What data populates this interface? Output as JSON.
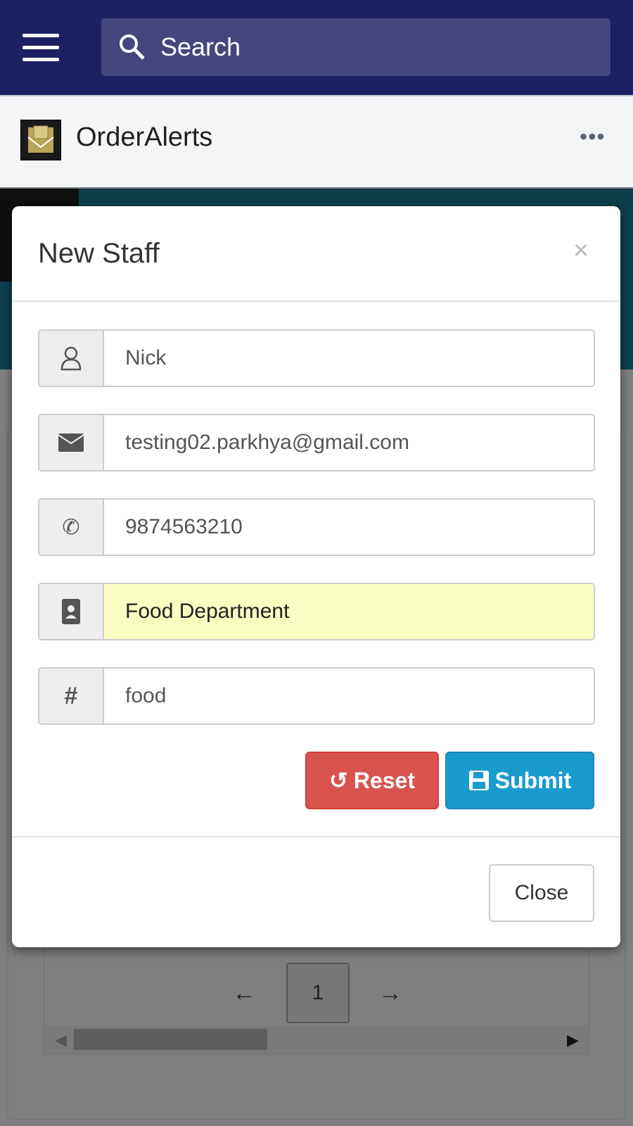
{
  "topbar": {
    "search_placeholder": "Search"
  },
  "app": {
    "title": "OrderAlerts",
    "more": "•••"
  },
  "modal": {
    "title": "New Staff",
    "close_x": "×",
    "fields": [
      {
        "icon": "user-icon",
        "value": "Nick"
      },
      {
        "icon": "envelope-icon",
        "value": "testing02.parkhya@gmail.com"
      },
      {
        "icon": "phone-icon",
        "value": "9874563210"
      },
      {
        "icon": "address-book-icon",
        "value": "Food Department",
        "highlight": "#fafdc2"
      },
      {
        "icon": "hash-icon",
        "symbol": "#",
        "value": "food"
      }
    ],
    "reset_label": "Reset",
    "submit_label": "Submit",
    "close_label": "Close"
  },
  "pagination": {
    "prev": "←",
    "current": "1",
    "next": "→"
  },
  "colors": {
    "header": "#1d2161",
    "reset": "#d9534f",
    "submit": "#1a9bd0"
  }
}
